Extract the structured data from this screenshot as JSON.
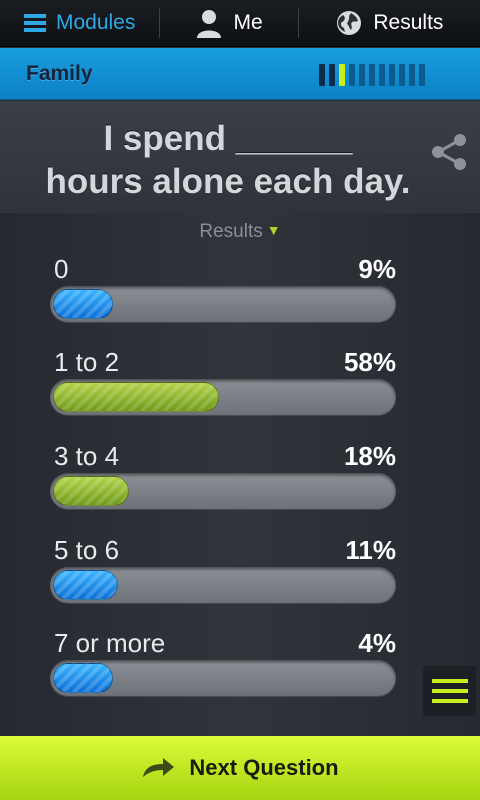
{
  "nav": {
    "modules_label": "Modules",
    "me_label": "Me",
    "results_label": "Results"
  },
  "category": {
    "title": "Family",
    "progress": {
      "total": 11,
      "completed": 2,
      "current_index": 3
    }
  },
  "question": {
    "line1": "I spend ______",
    "line2": "hours alone each day."
  },
  "results": {
    "toggle_label": "Results",
    "items": [
      {
        "label": "0",
        "percent_text": "9%",
        "percent": 9,
        "color": "blue"
      },
      {
        "label": "1 to 2",
        "percent_text": "58%",
        "percent": 58,
        "color": "green"
      },
      {
        "label": "3 to 4",
        "percent_text": "18%",
        "percent": 18,
        "color": "green"
      },
      {
        "label": "5 to 6",
        "percent_text": "11%",
        "percent": 11,
        "color": "blue"
      },
      {
        "label": "7 or more",
        "percent_text": "4%",
        "percent": 4,
        "color": "blue"
      }
    ]
  },
  "footer": {
    "next_label": "Next Question"
  },
  "colors": {
    "accent_blue": "#1a9fe0",
    "accent_green": "#c6ef1e"
  }
}
